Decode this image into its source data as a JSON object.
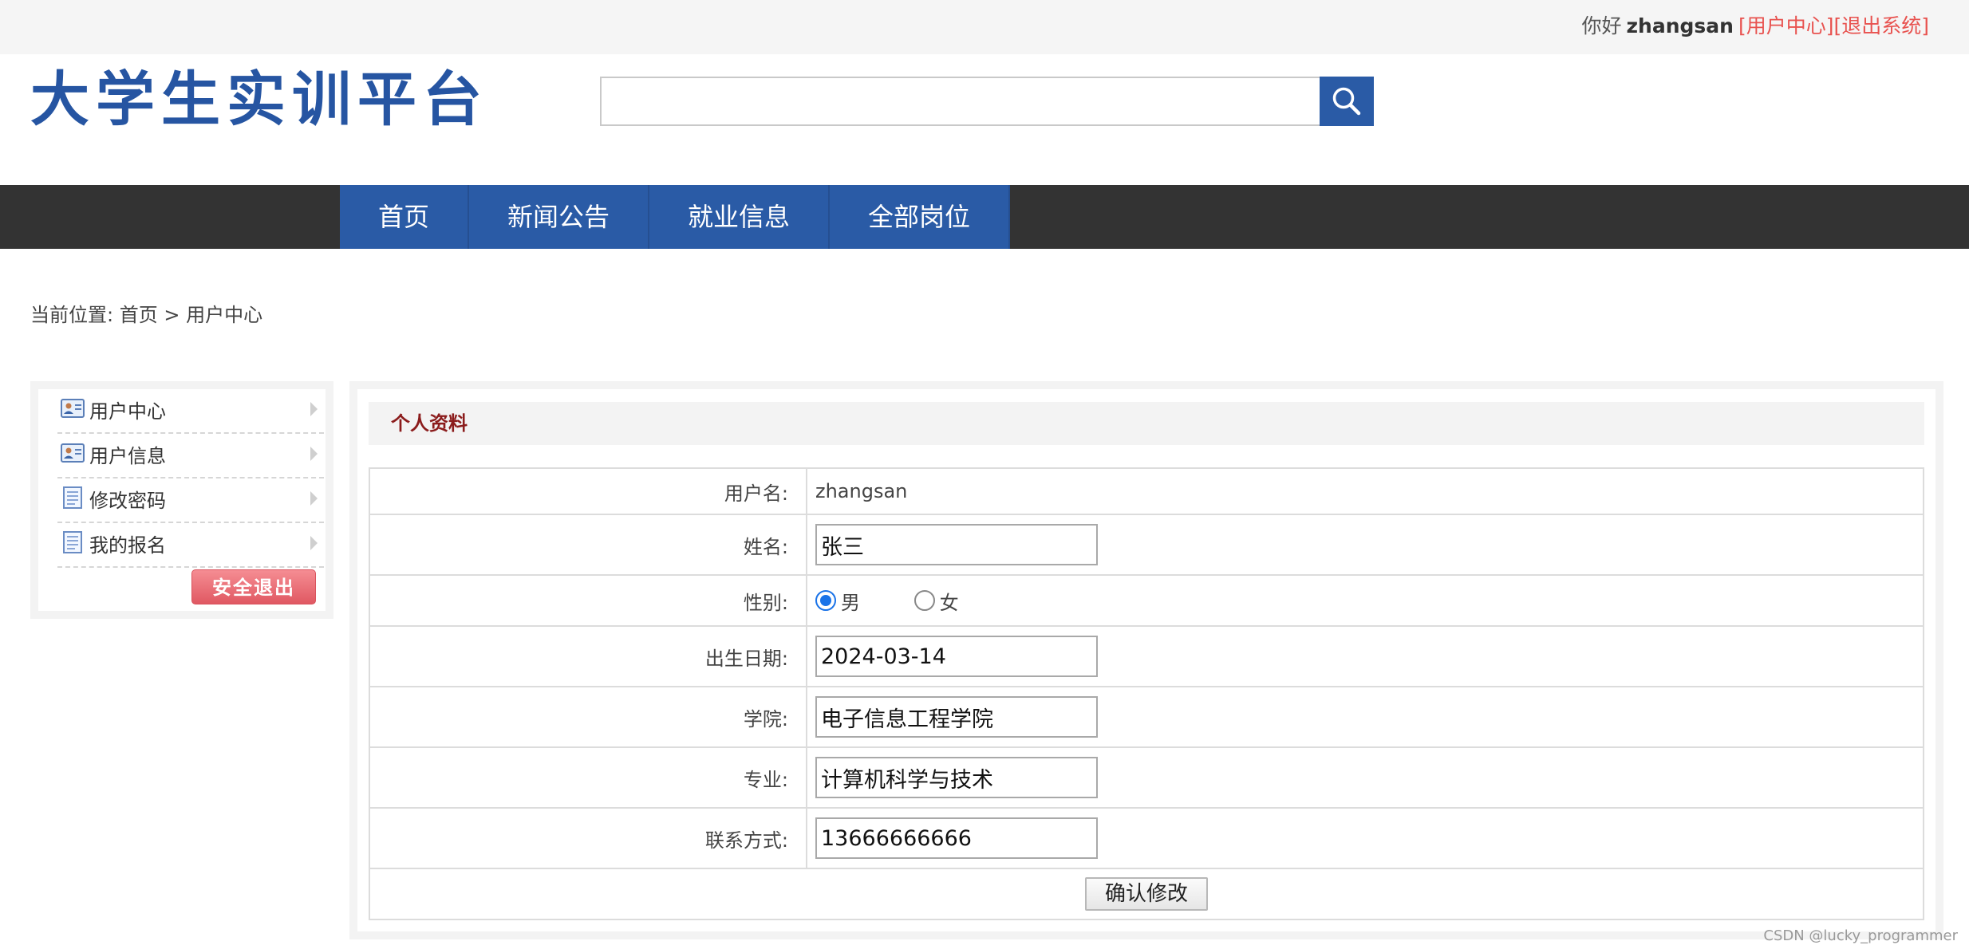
{
  "topbar": {
    "greeting": "你好",
    "username": "zhangsan",
    "user_center_link": "[用户中心]",
    "logout_link": "[退出系统]"
  },
  "header": {
    "logo_text": "大学生实训平台",
    "search": {
      "value": "",
      "placeholder": ""
    }
  },
  "nav": {
    "items": [
      {
        "label": "首页"
      },
      {
        "label": "新闻公告"
      },
      {
        "label": "就业信息"
      },
      {
        "label": "全部岗位"
      }
    ]
  },
  "breadcrumb": {
    "prefix": "当前位置:",
    "home": "首页",
    "separator": ">",
    "current": "用户中心"
  },
  "sidebar": {
    "items": [
      {
        "label": "用户中心",
        "icon": "user-card-icon"
      },
      {
        "label": "用户信息",
        "icon": "user-card-icon"
      },
      {
        "label": "修改密码",
        "icon": "document-icon"
      },
      {
        "label": "我的报名",
        "icon": "document-icon"
      }
    ],
    "logout_label": "安全退出"
  },
  "profile": {
    "title": "个人资料",
    "username_label": "用户名:",
    "username_value": "zhangsan",
    "name_label": "姓名:",
    "name_value": "张三",
    "gender_label": "性别:",
    "gender_options": [
      {
        "label": "男",
        "checked": true
      },
      {
        "label": "女",
        "checked": false
      }
    ],
    "birth_label": "出生日期:",
    "birth_value": "2024-03-14",
    "college_label": "学院:",
    "college_value": "电子信息工程学院",
    "major_label": "专业:",
    "major_value": "计算机科学与技术",
    "contact_label": "联系方式:",
    "contact_value": "13666666666",
    "submit_label": "确认修改"
  },
  "watermark": "CSDN @lucky_programmer",
  "colors": {
    "brand_blue": "#2a5ba6",
    "nav_dark": "#333333",
    "link_red": "#e8524f",
    "section_title": "#8b1c1c"
  }
}
